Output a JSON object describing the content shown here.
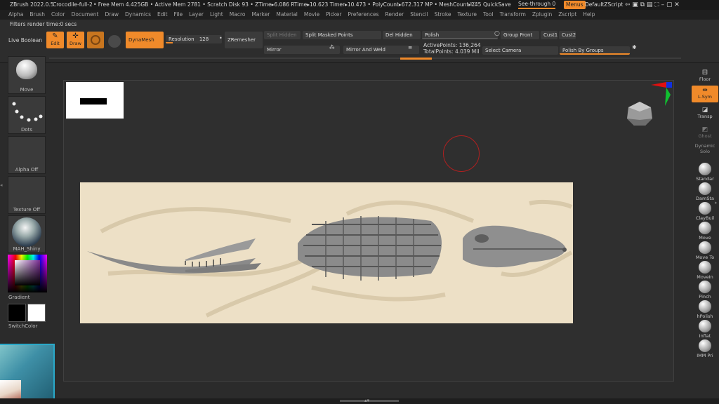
{
  "titlebar": {
    "app": "ZBrush 2022.0.5",
    "doc": "Crocodile-full-2",
    "stats": "• Free Mem 4.425GB • Active Mem 2781 • Scratch Disk 93 • ZTime▸6.086 RTime▸10.623 Timer▸10.473 • PolyCount▸672.317 MP • MeshCount▸245",
    "ac": "AC",
    "quicksave": "QuickSave",
    "seethrough": "See-through  0",
    "menus": "Menus",
    "script": "DefaultZScript"
  },
  "menus": [
    "Alpha",
    "Brush",
    "Color",
    "Document",
    "Draw",
    "Dynamics",
    "Edit",
    "File",
    "Layer",
    "Light",
    "Macro",
    "Marker",
    "Material",
    "Movie",
    "Picker",
    "Preferences",
    "Render",
    "Stencil",
    "Stroke",
    "Texture",
    "Tool",
    "Transform",
    "Zplugin",
    "Zscript",
    "Help"
  ],
  "shelf": {
    "filters": "Filters render time:0 secs",
    "live_boolean": "Live Boolean",
    "edit": "Edit",
    "draw": "Draw",
    "dynamesh": "DynaMesh",
    "resolution_label": "Resolution",
    "resolution_value": "128",
    "resolution_fill": 0.12,
    "zremesher": "ZRemesher",
    "split_hidden": "Split Hidden",
    "split_masked": "Split Masked Points",
    "del_hidden": "Del Hidden",
    "polish": "Polish",
    "group_front": "Group Front",
    "cust1": "Cust1",
    "cust2": "Cust2",
    "mirror": "Mirror",
    "mirror_weld": "Mirror And Weld",
    "active_points": "ActivePoints: 136,264",
    "total_points": "TotalPoints: 4.039 Mil",
    "select_camera": "Select Camera",
    "polish_groups": "Polish By Groups"
  },
  "left": {
    "brush": "Move",
    "stroke": "Dots",
    "alpha": "Alpha Off",
    "texture": "Texture Off",
    "material": "MAH_Shiny",
    "gradient": "Gradient",
    "switchcolor": "SwitchColor"
  },
  "right": {
    "floor": "Floor",
    "lsym": "L.Sym",
    "transp": "Transp",
    "ghost": "Ghost",
    "dynamic": "Dynamic",
    "solo": "Solo",
    "brushes": [
      "Standar",
      "DamSta",
      "ClayBuil",
      "Move",
      "Move To",
      "MoveIn",
      "Pinch",
      "hPolish",
      "Inflat",
      "IMM Pri"
    ]
  },
  "colors": {
    "accent": "#f08a2a",
    "relief_bg": "#ede0c6",
    "primary_color": "#000000",
    "secondary_color": "#ffffff"
  }
}
